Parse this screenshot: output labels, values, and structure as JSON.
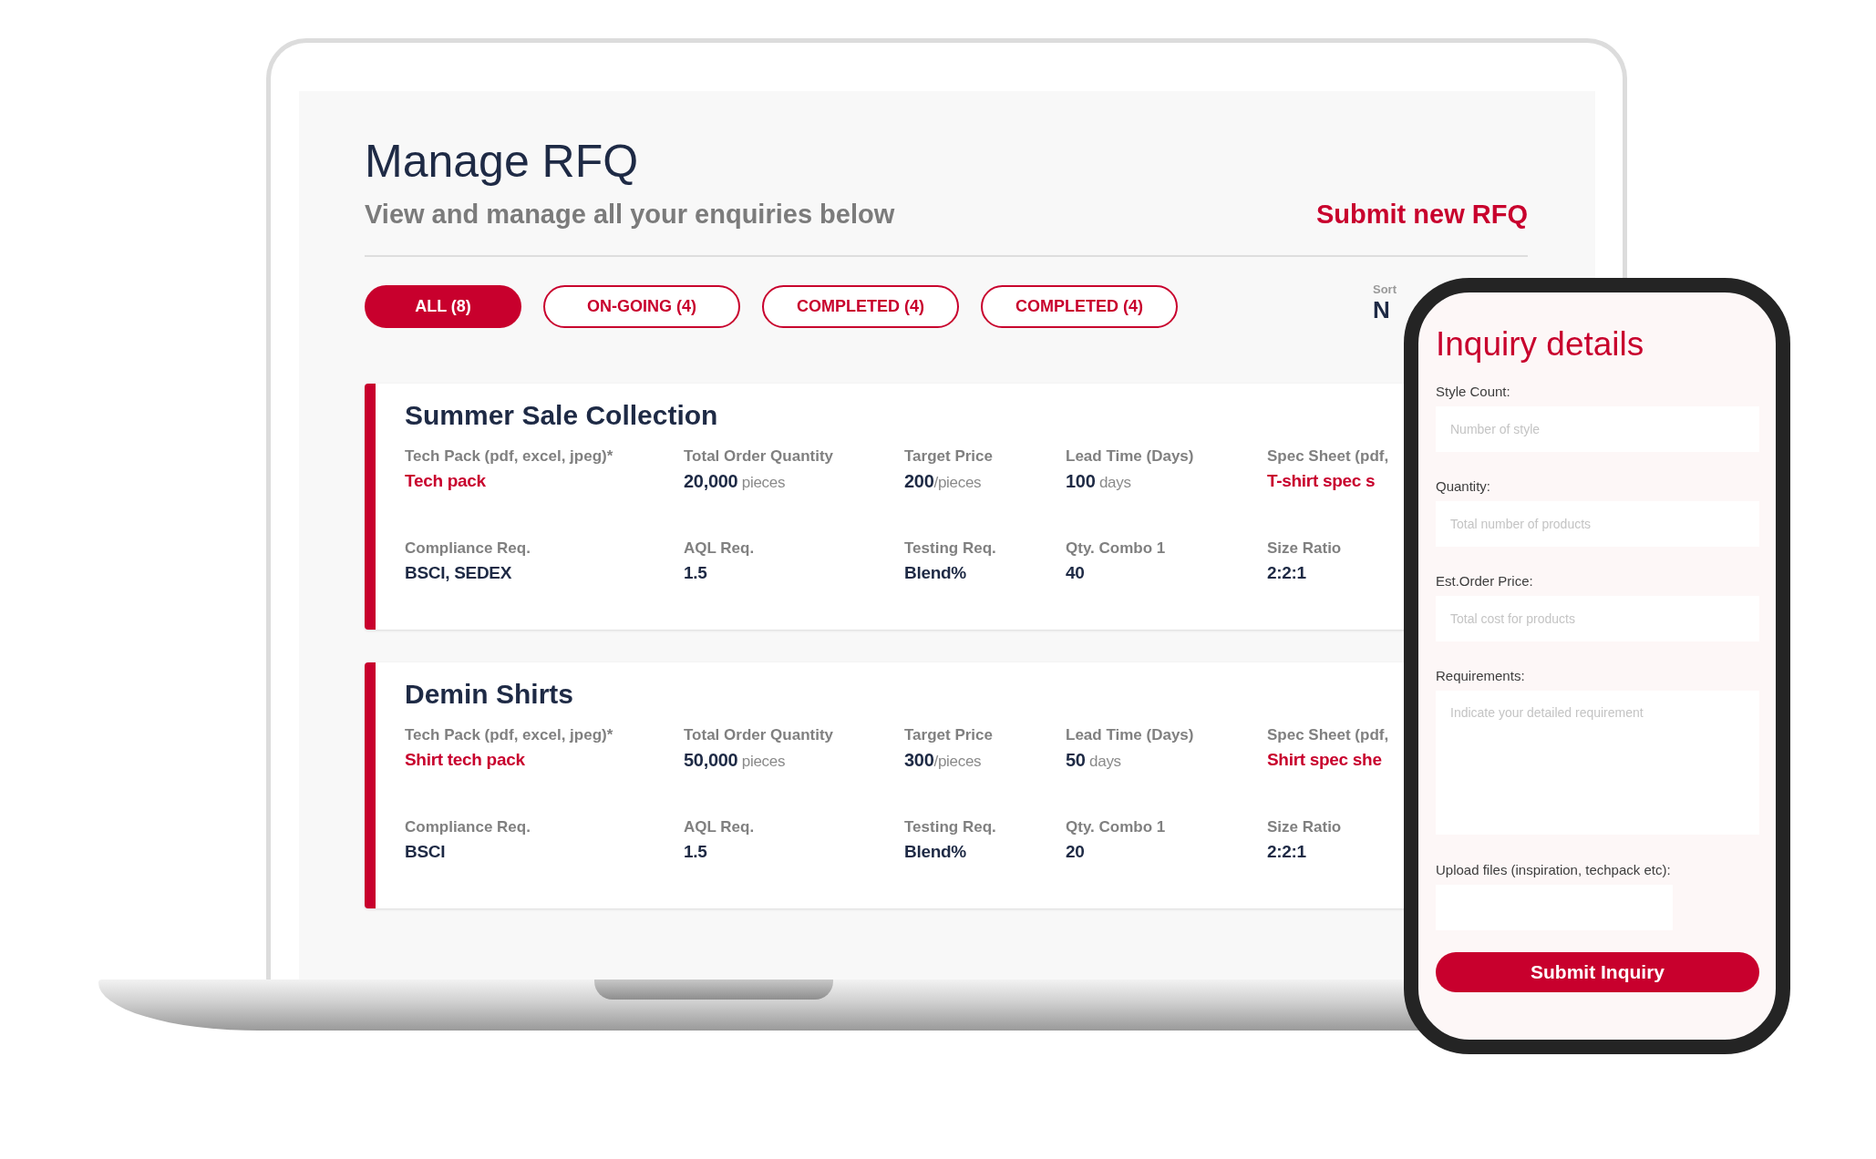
{
  "page": {
    "title": "Manage RFQ",
    "subtitle": "View and manage all your enquiries below",
    "action": "Submit new RFQ"
  },
  "tabs": [
    {
      "label": "ALL (8)",
      "selected": true
    },
    {
      "label": "ON-GOING (4)",
      "selected": false
    },
    {
      "label": "COMPLETED (4)",
      "selected": false
    },
    {
      "label": "COMPLETED (4)",
      "selected": false
    }
  ],
  "sort": {
    "label": "Sort",
    "value": "N"
  },
  "rfqs": [
    {
      "title": "Summer Sale Collection",
      "fields": [
        {
          "label": "Tech Pack (pdf, excel, jpeg)*",
          "value": "Tech pack",
          "kind": "link"
        },
        {
          "label": "Total Order Quantity",
          "value": "**20,000** pieces",
          "kind": "measure"
        },
        {
          "label": "Target Price",
          "value": "**200**/pieces",
          "kind": "measure"
        },
        {
          "label": "Lead Time (Days)",
          "value": "**100** days",
          "kind": "measure"
        },
        {
          "label": "Spec Sheet (pdf,",
          "value": "T-shirt spec s",
          "kind": "link"
        },
        {
          "label": "Compliance Req.",
          "value": "BSCI, SEDEX",
          "kind": "text"
        },
        {
          "label": "AQL Req.",
          "value": "1.5",
          "kind": "text"
        },
        {
          "label": "Testing Req.",
          "value": "Blend%",
          "kind": "text"
        },
        {
          "label": "Qty. Combo 1",
          "value": "40",
          "kind": "text"
        },
        {
          "label": "Size Ratio",
          "value": "2:2:1",
          "kind": "text"
        }
      ]
    },
    {
      "title": "Demin Shirts",
      "fields": [
        {
          "label": "Tech Pack (pdf, excel, jpeg)*",
          "value": "Shirt tech pack",
          "kind": "link"
        },
        {
          "label": "Total Order Quantity",
          "value": "**50,000** pieces",
          "kind": "measure"
        },
        {
          "label": "Target Price",
          "value": "**300**/pieces",
          "kind": "measure"
        },
        {
          "label": "Lead Time (Days)",
          "value": "**50** days",
          "kind": "measure"
        },
        {
          "label": "Spec Sheet (pdf,",
          "value": "Shirt spec she",
          "kind": "link"
        },
        {
          "label": "Compliance Req.",
          "value": "BSCI",
          "kind": "text"
        },
        {
          "label": "AQL Req.",
          "value": "1.5",
          "kind": "text"
        },
        {
          "label": "Testing Req.",
          "value": "Blend%",
          "kind": "text"
        },
        {
          "label": "Qty. Combo 1",
          "value": "20",
          "kind": "text"
        },
        {
          "label": "Size Ratio",
          "value": "2:2:1",
          "kind": "text"
        }
      ]
    }
  ],
  "inquiry": {
    "title": "Inquiry details",
    "fields": [
      {
        "label": "Style Count:",
        "placeholder": "Number of style",
        "kind": "input"
      },
      {
        "label": "Quantity:",
        "placeholder": "Total number of products",
        "kind": "input"
      },
      {
        "label": "Est.Order Price:",
        "placeholder": "Total cost for products",
        "kind": "input"
      },
      {
        "label": "Requirements:",
        "placeholder": "Indicate your detailed requirement",
        "kind": "textarea"
      },
      {
        "label": "Upload files (inspiration, techpack etc):",
        "kind": "upload"
      }
    ],
    "submit": "Submit Inquiry"
  }
}
